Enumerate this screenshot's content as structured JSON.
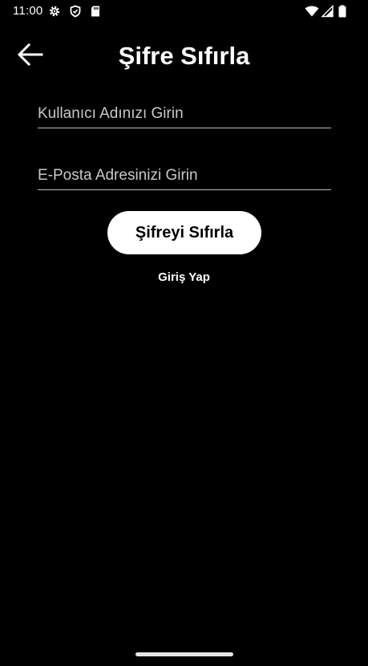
{
  "status_bar": {
    "time": "11:00",
    "icons": [
      "settings-icon",
      "shield-icon",
      "sd-card-icon",
      "wifi-icon",
      "signal-icon",
      "battery-icon"
    ]
  },
  "header": {
    "title": "Şifre Sıfırla",
    "back_icon": "arrow-left-icon"
  },
  "form": {
    "username_placeholder": "Kullanıcı Adınızı Girin",
    "username_value": "",
    "email_placeholder": "E-Posta Adresinizi Girin",
    "email_value": "",
    "reset_button_label": "Şifreyi Sıfırla",
    "login_link_label": "Giriş Yap"
  },
  "colors": {
    "background": "#000000",
    "text": "#ffffff",
    "button_bg": "#ffffff",
    "button_text": "#000000",
    "underline": "#bdbdbd"
  }
}
